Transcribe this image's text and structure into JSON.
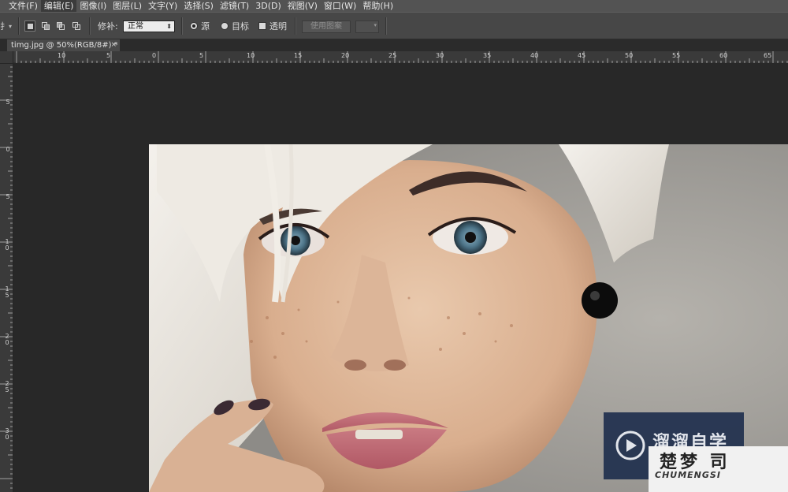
{
  "menubar": {
    "items": [
      "文件(F)",
      "编辑(E)",
      "图像(I)",
      "图层(L)",
      "文字(Y)",
      "选择(S)",
      "滤镜(T)",
      "3D(D)",
      "视图(V)",
      "窗口(W)",
      "帮助(H)"
    ],
    "active_index": 1
  },
  "options_bar": {
    "tool_glyph": "扌",
    "patch_label": "修补:",
    "patch_mode": "正常",
    "source_label": "源",
    "target_label": "目标",
    "transparent_label": "透明",
    "use_pattern_label": "使用图案",
    "source_selected": true,
    "transparent_checked": false
  },
  "document_tab": {
    "title": "timg.jpg @ 50%(RGB/8#) *",
    "close_glyph": "×"
  },
  "rulers": {
    "top_labels": [
      "10",
      "5",
      "0",
      "5",
      "10",
      "15",
      "20",
      "25",
      "30",
      "35",
      "40",
      "45",
      "50",
      "55",
      "60",
      "65"
    ],
    "left_labels": [
      "5",
      "0",
      "5",
      "10",
      "15",
      "20",
      "25",
      "30"
    ]
  },
  "watermarks": {
    "brand_cn": "溜溜自学",
    "brand2_cn": "楚梦 司",
    "brand2_en": "CHUMENGSI"
  },
  "colors": {
    "menubar": "#535353",
    "options_bar": "#474747",
    "workspace": "#282828",
    "ruler": "#3a3a3a"
  }
}
